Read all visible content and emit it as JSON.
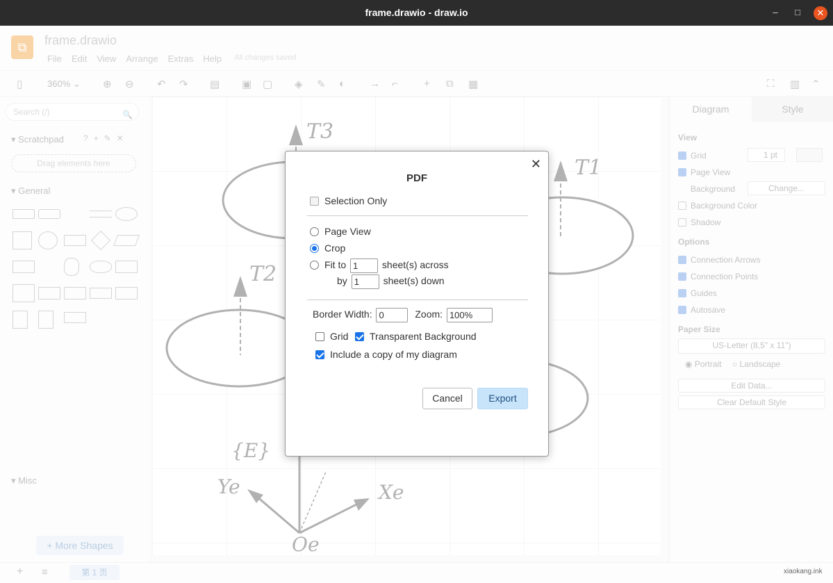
{
  "window": {
    "title": "frame.drawio - draw.io",
    "minimize": "–",
    "maximize": "□",
    "close": "✕"
  },
  "app": {
    "doc_title": "frame.drawio",
    "menu": [
      "File",
      "Edit",
      "View",
      "Arrange",
      "Extras",
      "Help"
    ],
    "save_status": "All changes saved",
    "zoom": "360%"
  },
  "sidebar": {
    "search_placeholder": "Search (/)",
    "scratchpad": "Scratchpad",
    "drag_here": "Drag elements here",
    "general": "General",
    "misc": "Misc",
    "more_shapes": "+ More Shapes"
  },
  "canvas": {
    "labels": [
      "T3",
      "T1",
      "T2",
      "{E}",
      "Ye",
      "Xe",
      "Oe"
    ]
  },
  "format_panel": {
    "tabs": [
      "Diagram",
      "Style"
    ],
    "view": "View",
    "grid": "Grid",
    "grid_size": "1 pt",
    "page_view": "Page View",
    "background": "Background",
    "change": "Change...",
    "background_color": "Background Color",
    "shadow": "Shadow",
    "options": "Options",
    "connection_arrows": "Connection Arrows",
    "connection_points": "Connection Points",
    "guides": "Guides",
    "autosave": "Autosave",
    "paper_size": "Paper Size",
    "paper_value": "US-Letter (8,5\" x 11\")",
    "portrait": "Portrait",
    "landscape": "Landscape",
    "edit_data": "Edit Data...",
    "clear_default_style": "Clear Default Style"
  },
  "status": {
    "page_tab": "第 1 页",
    "watermark": "xiaokang.ink"
  },
  "dialog": {
    "title": "PDF",
    "selection_only": "Selection Only",
    "page_view": "Page View",
    "crop": "Crop",
    "fit_to": "Fit to",
    "fit_across": "1",
    "sheets_across": "sheet(s) across",
    "by": "by",
    "fit_down": "1",
    "sheets_down": "sheet(s) down",
    "border_width_label": "Border Width:",
    "border_width": "0",
    "zoom_label": "Zoom:",
    "zoom": "100%",
    "grid": "Grid",
    "transparent_background": "Transparent Background",
    "include_copy": "Include a copy of my diagram",
    "cancel": "Cancel",
    "export": "Export",
    "close": "✕"
  }
}
